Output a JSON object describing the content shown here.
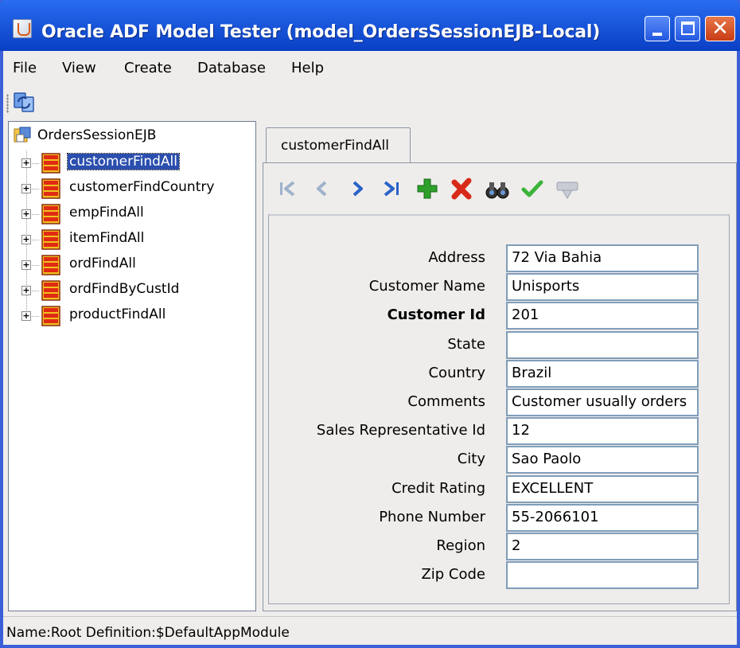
{
  "window": {
    "title": "Oracle ADF Model Tester (model_OrdersSessionEJB-Local)",
    "close_glyph": "✕"
  },
  "menu": {
    "items": [
      "File",
      "View",
      "Create",
      "Database",
      "Help"
    ]
  },
  "toolbar": {
    "icons": [
      "refresh-icon"
    ]
  },
  "tree": {
    "root_label": "OrdersSessionEJB",
    "items": [
      {
        "label": "customerFindAll",
        "selected": true
      },
      {
        "label": "customerFindCountry",
        "selected": false
      },
      {
        "label": "empFindAll",
        "selected": false
      },
      {
        "label": "itemFindAll",
        "selected": false
      },
      {
        "label": "ordFindAll",
        "selected": false
      },
      {
        "label": "ordFindByCustId",
        "selected": false
      },
      {
        "label": "productFindAll",
        "selected": false
      }
    ]
  },
  "tab": {
    "label": "customerFindAll"
  },
  "nav": {
    "icons": [
      "first-record-icon",
      "previous-record-icon",
      "next-record-icon",
      "last-record-icon",
      "insert-record-icon",
      "delete-record-icon",
      "find-icon",
      "commit-icon",
      "rollback-icon"
    ]
  },
  "form": {
    "fields": [
      {
        "label": "Address",
        "value": "72 Via Bahia",
        "bold": false
      },
      {
        "label": "Customer Name",
        "value": "Unisports",
        "bold": false
      },
      {
        "label": "Customer Id",
        "value": "201",
        "bold": true
      },
      {
        "label": "State",
        "value": "",
        "bold": false
      },
      {
        "label": "Country",
        "value": "Brazil",
        "bold": false
      },
      {
        "label": "Comments",
        "value": "Customer usually orders",
        "bold": false
      },
      {
        "label": "Sales Representative Id",
        "value": "12",
        "bold": false
      },
      {
        "label": "City",
        "value": "Sao Paolo",
        "bold": false
      },
      {
        "label": "Credit Rating",
        "value": "EXCELLENT",
        "bold": false
      },
      {
        "label": "Phone Number",
        "value": "55-2066101",
        "bold": false
      },
      {
        "label": "Region",
        "value": "2",
        "bold": false
      },
      {
        "label": "Zip Code",
        "value": "",
        "bold": false
      }
    ]
  },
  "status": {
    "text": "Name:Root  Definition:$DefaultAppModule"
  },
  "colors": {
    "titlebar": "#1a58dc",
    "selection": "#2b4fae",
    "input_border": "#7f9db9",
    "delete_red": "#d82a1a",
    "insert_green": "#2ea02a",
    "commit_green": "#3cb43c"
  }
}
